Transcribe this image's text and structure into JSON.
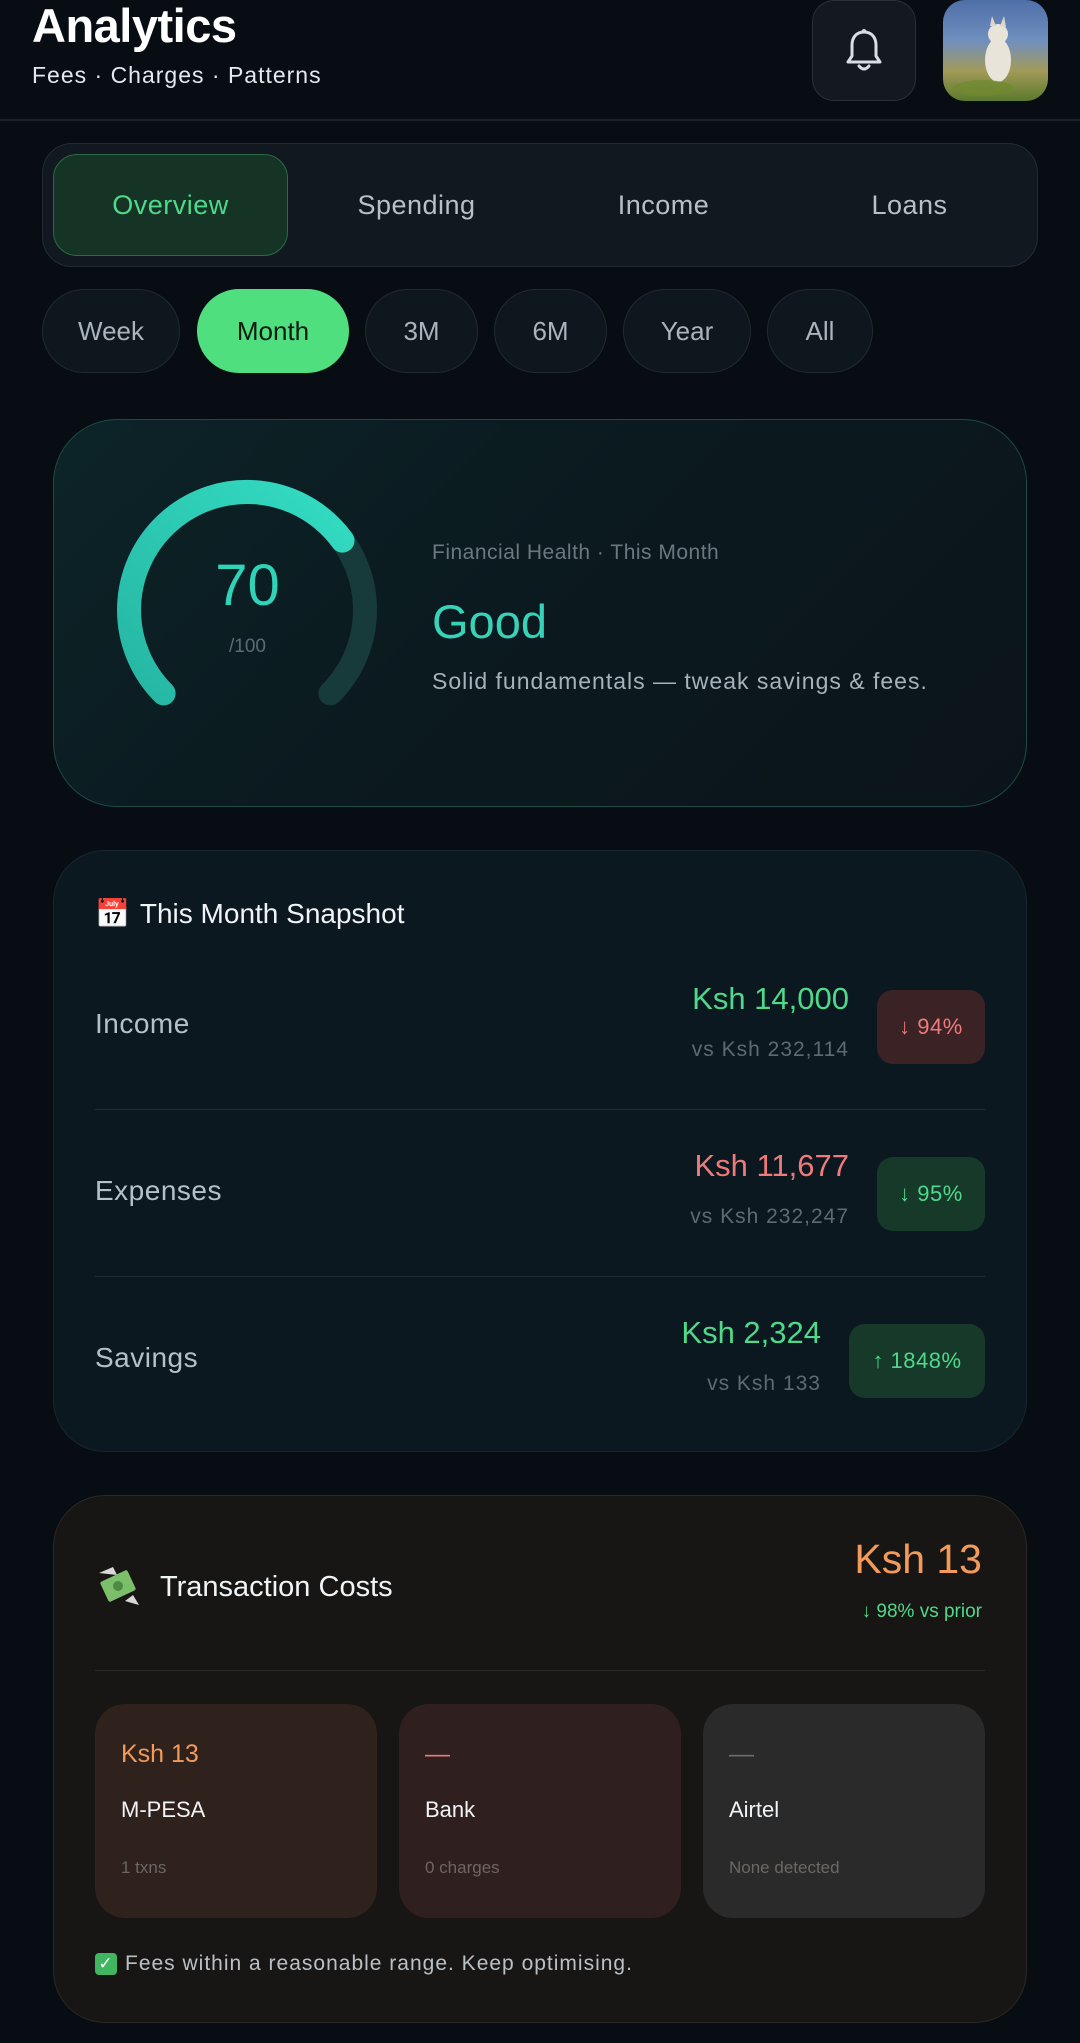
{
  "header": {
    "title": "Analytics",
    "subtitle": "Fees · Charges · Patterns",
    "bell_icon": "bell-icon"
  },
  "tabs": [
    {
      "label": "Overview",
      "active": true
    },
    {
      "label": "Spending",
      "active": false
    },
    {
      "label": "Income",
      "active": false
    },
    {
      "label": "Loans",
      "active": false
    }
  ],
  "periods": [
    {
      "label": "Week",
      "active": false
    },
    {
      "label": "Month",
      "active": true
    },
    {
      "label": "3M",
      "active": false
    },
    {
      "label": "6M",
      "active": false
    },
    {
      "label": "Year",
      "active": false
    },
    {
      "label": "All",
      "active": false
    }
  ],
  "health": {
    "score": "70",
    "max": "/100",
    "score_fraction": 0.7,
    "label": "Financial Health · This Month",
    "status": "Good",
    "description": "Solid fundamentals — tweak savings & fees."
  },
  "snapshot": {
    "icon": "📅",
    "title": "This Month Snapshot",
    "rows": [
      {
        "label": "Income",
        "value": "Ksh 14,000",
        "previous": "vs Ksh 232,114",
        "change": "↓ 94%"
      },
      {
        "label": "Expenses",
        "value": "Ksh 11,677",
        "previous": "vs Ksh 232,247",
        "change": "↓ 95%"
      },
      {
        "label": "Savings",
        "value": "Ksh 2,324",
        "previous": "vs Ksh 133",
        "change": "↑ 1848%"
      }
    ]
  },
  "transaction_costs": {
    "title": "Transaction Costs",
    "icon": "money-with-wings-icon",
    "total": "Ksh 13",
    "change": "↓ 98% vs prior",
    "providers": [
      {
        "amount": "Ksh 13",
        "name": "M-PESA",
        "note": "1 txns"
      },
      {
        "amount": "—",
        "name": "Bank",
        "note": "0 charges"
      },
      {
        "amount": "—",
        "name": "Airtel",
        "note": "None detected"
      }
    ],
    "footer": "Fees within a reasonable range. Keep optimising."
  },
  "colors": {
    "accent_green": "#4fdf7e",
    "teal": "#2fd3b8",
    "red": "#f07a7a",
    "orange": "#f39a5a"
  }
}
